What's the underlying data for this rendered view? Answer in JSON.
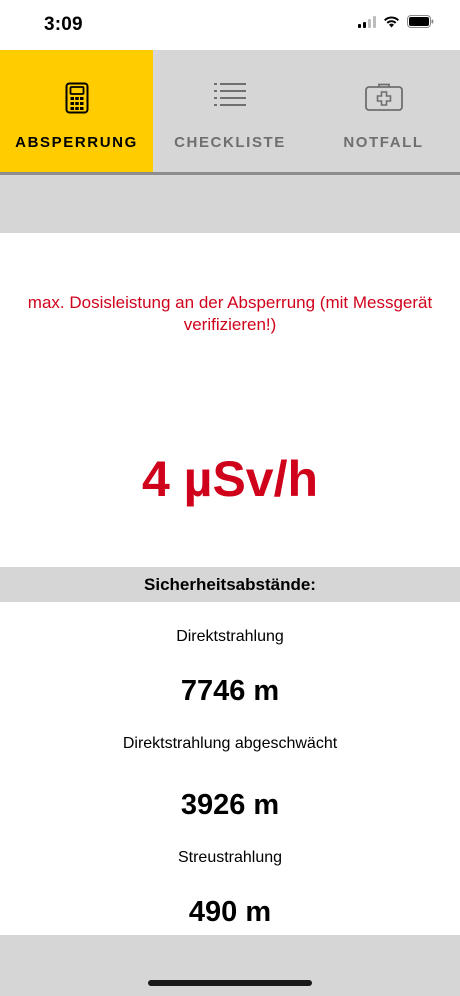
{
  "status_bar": {
    "time": "3:09",
    "icons": [
      "signal-icon",
      "wifi-icon",
      "battery-icon"
    ]
  },
  "tabs": [
    {
      "label": "ABSPERRUNG",
      "icon": "dosimeter-icon",
      "active": true
    },
    {
      "label": "CHECKLISTE",
      "icon": "list-icon",
      "active": false
    },
    {
      "label": "NOTFALL",
      "icon": "first-aid-kit-icon",
      "active": false
    }
  ],
  "dose": {
    "note": "max. Dosisleistung an der Absperrung (mit Messgerät verifizieren!)",
    "value": "4 µSv/h"
  },
  "safety": {
    "header": "Sicherheitsabstände:",
    "items": [
      {
        "label": "Direktstrahlung",
        "value": "7746 m"
      },
      {
        "label": "Direktstrahlung abgeschwächt",
        "value": "3926 m"
      },
      {
        "label": "Streustrahlung",
        "value": "490 m"
      }
    ]
  },
  "colors": {
    "accent": "#ffcc00",
    "alert_red": "#d0021b",
    "tab_background": "#d6d6d6",
    "inactive_tab_text": "#6f6f6f"
  }
}
